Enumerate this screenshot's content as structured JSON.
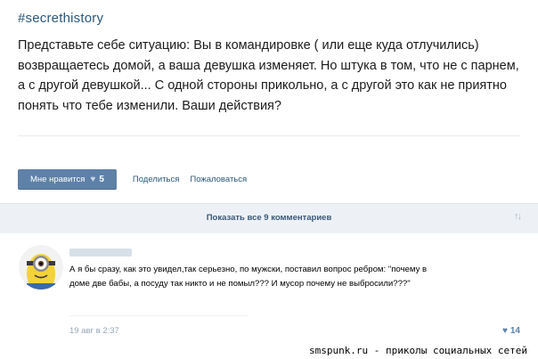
{
  "post": {
    "hashtag": "#secrethistory",
    "text_lines": [
      "Представьте себе ситуацию: Вы в командировке ( или еще куда отлучились)",
      "возвращаетесь домой, а ваша девушка изменяет. Но штука в том, что не с парнем,",
      "а с другой девушкой... С одной стороны прикольно, а с другой это как не приятно",
      "понять что тебе изменили. Ваши действия?"
    ],
    "actions": {
      "like_label": "Мне нравится",
      "like_icon": "heart-icon",
      "like_count": "5",
      "share_label": "Поделиться",
      "report_label": "Пожаловаться"
    }
  },
  "comments_bar": {
    "show_all_label": "Показать все 9 комментариев",
    "sort_icon": "sort-arrows-icon"
  },
  "comment": {
    "avatar_icon": "minion-avatar",
    "text_lines": [
      "А я бы сразу, как это увидел,так серьезно, по мужски, поставил вопрос ребром: \"почему в",
      "доме две бабы, а посуду так никто и не помыл??? И мусор почему не выбросили???\""
    ],
    "date": "19 авг в 2:37",
    "likes": "14",
    "likes_icon": "heart-icon"
  },
  "watermark": "smspunk.ru - приколы социальных сетей",
  "colors": {
    "link": "#2b587a",
    "button": "#5e81a8",
    "bar": "#edf1f5"
  }
}
